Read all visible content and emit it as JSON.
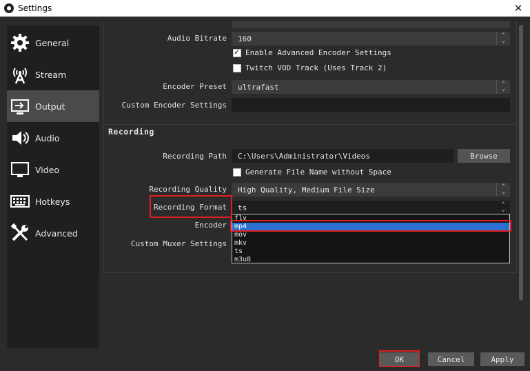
{
  "window": {
    "title": "Settings",
    "close_glyph": "✕"
  },
  "sidebar": {
    "items": [
      {
        "label": "General",
        "icon": "gear-icon"
      },
      {
        "label": "Stream",
        "icon": "broadcast-icon"
      },
      {
        "label": "Output",
        "icon": "monitor-output-icon",
        "active": true
      },
      {
        "label": "Audio",
        "icon": "speaker-icon"
      },
      {
        "label": "Video",
        "icon": "monitor-icon"
      },
      {
        "label": "Hotkeys",
        "icon": "keyboard-icon"
      },
      {
        "label": "Advanced",
        "icon": "tools-icon"
      }
    ]
  },
  "streaming": {
    "audio_bitrate_label": "Audio Bitrate",
    "audio_bitrate_value": "160",
    "enable_advanced_label": "Enable Advanced Encoder Settings",
    "enable_advanced_checked": true,
    "twitch_vod_label": "Twitch VOD Track (Uses Track 2)",
    "twitch_vod_checked": false,
    "encoder_preset_label": "Encoder Preset",
    "encoder_preset_value": "ultrafast",
    "custom_encoder_label": "Custom Encoder Settings",
    "custom_encoder_value": ""
  },
  "recording": {
    "title": "Recording",
    "path_label": "Recording Path",
    "path_value": "C:\\Users\\Administrator\\Videos",
    "browse_label": "Browse",
    "generate_name_label": "Generate File Name without Space",
    "generate_name_checked": false,
    "quality_label": "Recording Quality",
    "quality_value": "High Quality, Medium File Size",
    "format_label": "Recording Format",
    "format_value": "ts",
    "encoder_label": "Encoder",
    "muxer_label": "Custom Muxer Settings",
    "format_options": [
      "flv",
      "mp4",
      "mov",
      "mkv",
      "ts",
      "m3u8"
    ],
    "highlighted_option": "mp4"
  },
  "footer": {
    "ok": "OK",
    "cancel": "Cancel",
    "apply": "Apply"
  },
  "colors": {
    "highlight": "#e02020",
    "selection": "#2a6fd1",
    "active_sidebar": "#4a4a4a"
  }
}
